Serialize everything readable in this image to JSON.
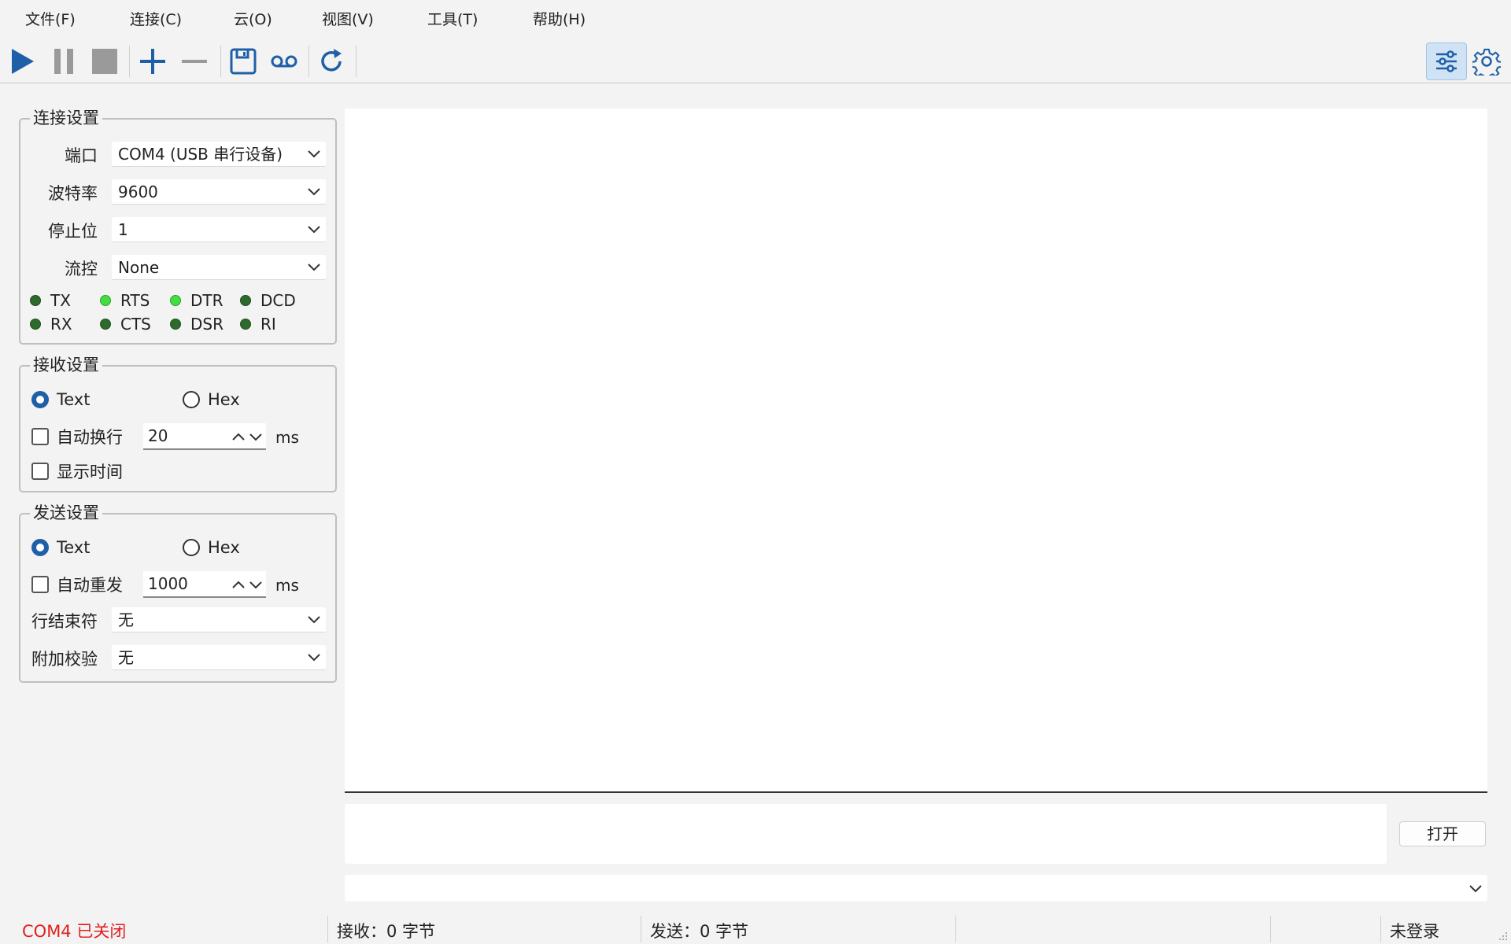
{
  "menu": [
    "文件(F)",
    "连接(C)",
    "云(O)",
    "视图(V)",
    "工具(T)",
    "帮助(H)"
  ],
  "toolbar": {
    "icons": [
      "play-icon",
      "pause-icon",
      "stop-icon",
      "plus-icon",
      "minus-icon",
      "save-icon",
      "record-icon",
      "refresh-icon",
      "settings-panel-icon",
      "gear-icon"
    ],
    "accent": "#1e5fa8"
  },
  "connection": {
    "title": "连接设置",
    "port_label": "端口",
    "port_value": "COM4 (USB 串行设备)",
    "baud_label": "波特率",
    "baud_value": "9600",
    "stop_label": "停止位",
    "stop_value": "1",
    "flow_label": "流控",
    "flow_value": "None",
    "signals_row1": [
      {
        "name": "TX",
        "on": false
      },
      {
        "name": "RTS",
        "on": true
      },
      {
        "name": "DTR",
        "on": true
      },
      {
        "name": "DCD",
        "on": false
      }
    ],
    "signals_row2": [
      {
        "name": "RX",
        "on": false
      },
      {
        "name": "CTS",
        "on": false
      },
      {
        "name": "DSR",
        "on": false
      },
      {
        "name": "RI",
        "on": false
      }
    ]
  },
  "receive": {
    "title": "接收设置",
    "text_label": "Text",
    "hex_label": "Hex",
    "mode": "Text",
    "auto_wrap_label": "自动换行",
    "auto_wrap_checked": false,
    "wrap_value": "20",
    "wrap_unit": "ms",
    "show_time_label": "显示时间",
    "show_time_checked": false
  },
  "send": {
    "title": "发送设置",
    "text_label": "Text",
    "hex_label": "Hex",
    "mode": "Text",
    "auto_resend_label": "自动重发",
    "auto_resend_checked": false,
    "resend_value": "1000",
    "resend_unit": "ms",
    "line_end_label": "行结束符",
    "line_end_value": "无",
    "checksum_label": "附加校验",
    "checksum_value": "无"
  },
  "open_button": "打开",
  "status": {
    "port_state": "COM4  已关闭",
    "port_state_color": "#e02020",
    "received": "接收：0 字节",
    "sent": "发送：0 字节",
    "login": "未登录"
  }
}
